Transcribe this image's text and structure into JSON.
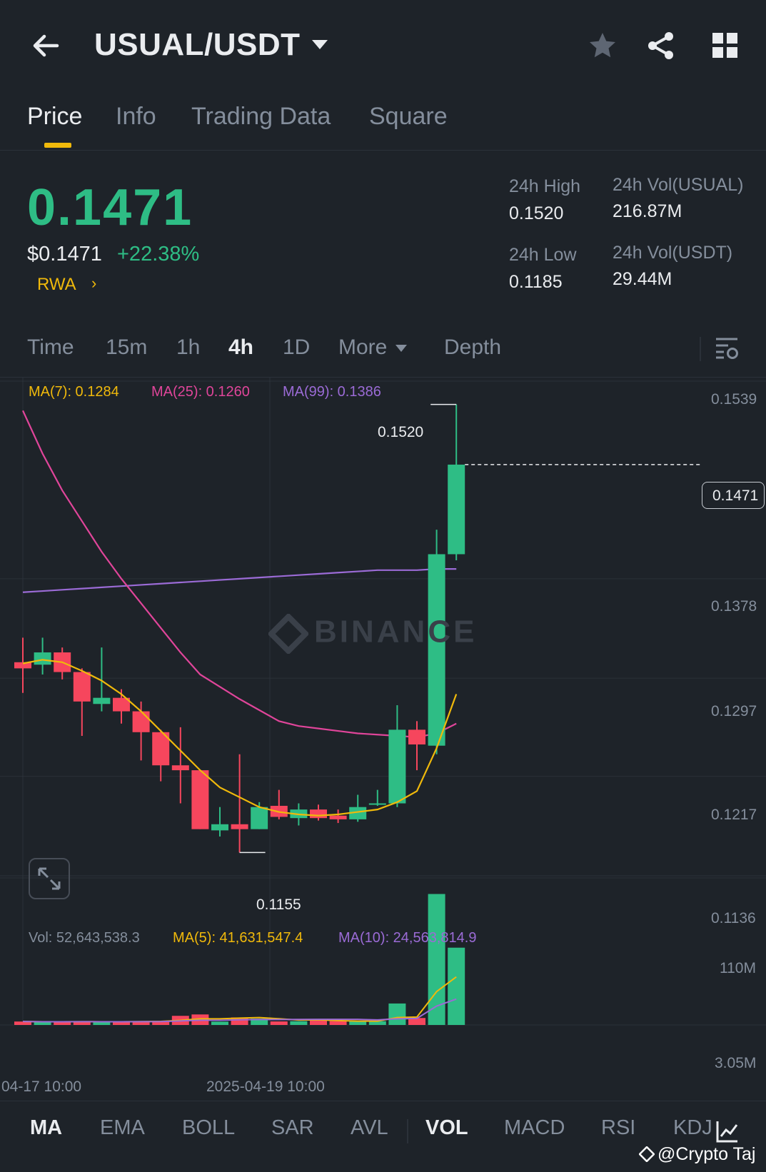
{
  "header": {
    "pair": "USUAL/USDT",
    "back_icon": "arrow-left-icon",
    "star_icon": "star-icon",
    "share_icon": "share-icon",
    "grid_icon": "grid-icon"
  },
  "tabs": [
    {
      "label": "Price",
      "active": true
    },
    {
      "label": "Info",
      "active": false
    },
    {
      "label": "Trading Data",
      "active": false
    },
    {
      "label": "Square",
      "active": false
    }
  ],
  "ticker": {
    "last_price": "0.1471",
    "fiat_price": "$0.1471",
    "change": "+22.38%",
    "tag": "RWA",
    "tag_arrow": "›",
    "high_label": "24h High",
    "high_value": "0.1520",
    "low_label": "24h Low",
    "low_value": "0.1185",
    "vol_base_label": "24h Vol(USUAL)",
    "vol_base_value": "216.87M",
    "vol_quote_label": "24h Vol(USDT)",
    "vol_quote_value": "29.44M"
  },
  "intervals": [
    {
      "label": "Time",
      "active": false
    },
    {
      "label": "15m",
      "active": false
    },
    {
      "label": "1h",
      "active": false
    },
    {
      "label": "4h",
      "active": true
    },
    {
      "label": "1D",
      "active": false
    },
    {
      "label": "More",
      "active": false
    },
    {
      "label": "Depth",
      "active": false
    }
  ],
  "ma_legend": {
    "ma7": "MA(7): 0.1284",
    "ma25": "MA(25): 0.1260",
    "ma99": "MA(99): 0.1386"
  },
  "vol_legend": {
    "vol": "Vol: 52,643,538.3",
    "ma5": "MA(5): 41,631,547.4",
    "ma10": "MA(10): 24,563,814.9"
  },
  "colors": {
    "up": "#2ebd85",
    "down": "#f6465d",
    "ma7": "#f0b90b",
    "ma25": "#e0459a",
    "ma99": "#9b6bd6",
    "background": "#1e2329"
  },
  "watermark": "BINANCE",
  "indicators": [
    {
      "label": "MA",
      "active": true
    },
    {
      "label": "EMA",
      "active": false
    },
    {
      "label": "BOLL",
      "active": false
    },
    {
      "label": "SAR",
      "active": false
    },
    {
      "label": "AVL",
      "active": false
    },
    {
      "label": "VOL",
      "active": true
    },
    {
      "label": "MACD",
      "active": false
    },
    {
      "label": "RSI",
      "active": false
    },
    {
      "label": "KDJ",
      "active": false
    }
  ],
  "footer_tag": "@Crypto Taj",
  "chart_data": {
    "type": "candlestick",
    "price_axis_labels": [
      "0.1539",
      "0.1378",
      "0.1297",
      "0.1217",
      "0.1136"
    ],
    "price_ylim": [
      0.1136,
      0.1539
    ],
    "current_price_label": "0.1471",
    "high_marker": "0.1520",
    "low_marker": "0.1155",
    "volume_axis_labels": [
      "110M",
      "3.05M"
    ],
    "x_labels": [
      "04-17 10:00",
      "2025-04-19 10:00"
    ],
    "candles": [
      {
        "o": 0.131,
        "h": 0.133,
        "l": 0.1285,
        "c": 0.1305
      },
      {
        "o": 0.1308,
        "h": 0.133,
        "l": 0.13,
        "c": 0.1318
      },
      {
        "o": 0.1318,
        "h": 0.1322,
        "l": 0.1296,
        "c": 0.1302
      },
      {
        "o": 0.1302,
        "h": 0.1305,
        "l": 0.125,
        "c": 0.1278
      },
      {
        "o": 0.1276,
        "h": 0.1322,
        "l": 0.127,
        "c": 0.1281
      },
      {
        "o": 0.1281,
        "h": 0.1288,
        "l": 0.126,
        "c": 0.127
      },
      {
        "o": 0.127,
        "h": 0.1278,
        "l": 0.123,
        "c": 0.1253
      },
      {
        "o": 0.1253,
        "h": 0.1255,
        "l": 0.1213,
        "c": 0.1226
      },
      {
        "o": 0.1226,
        "h": 0.1257,
        "l": 0.1195,
        "c": 0.1222
      },
      {
        "o": 0.1222,
        "h": 0.1222,
        "l": 0.1174,
        "c": 0.1174
      },
      {
        "o": 0.1173,
        "h": 0.1192,
        "l": 0.1168,
        "c": 0.1178
      },
      {
        "o": 0.1178,
        "h": 0.1235,
        "l": 0.1155,
        "c": 0.1174
      },
      {
        "o": 0.1174,
        "h": 0.1196,
        "l": 0.1174,
        "c": 0.1192
      },
      {
        "o": 0.1193,
        "h": 0.1206,
        "l": 0.1182,
        "c": 0.1184
      },
      {
        "o": 0.1183,
        "h": 0.1195,
        "l": 0.1177,
        "c": 0.119
      },
      {
        "o": 0.119,
        "h": 0.1194,
        "l": 0.1181,
        "c": 0.1183
      },
      {
        "o": 0.1185,
        "h": 0.119,
        "l": 0.1179,
        "c": 0.1182
      },
      {
        "o": 0.1182,
        "h": 0.1202,
        "l": 0.118,
        "c": 0.1192
      },
      {
        "o": 0.1194,
        "h": 0.1206,
        "l": 0.1193,
        "c": 0.1195
      },
      {
        "o": 0.1195,
        "h": 0.1275,
        "l": 0.1192,
        "c": 0.1255
      },
      {
        "o": 0.1255,
        "h": 0.1262,
        "l": 0.1222,
        "c": 0.1243
      },
      {
        "o": 0.1242,
        "h": 0.1418,
        "l": 0.1235,
        "c": 0.1398
      },
      {
        "o": 0.1398,
        "h": 0.152,
        "l": 0.1393,
        "c": 0.1471
      }
    ],
    "ma7": [
      0.1309,
      0.1312,
      0.131,
      0.1303,
      0.1295,
      0.1284,
      0.127,
      0.1254,
      0.1238,
      0.1222,
      0.1208,
      0.12,
      0.1192,
      0.1188,
      0.1186,
      0.1185,
      0.1186,
      0.1188,
      0.119,
      0.1196,
      0.1205,
      0.124,
      0.1284
    ],
    "ma25": [
      0.1515,
      0.148,
      0.145,
      0.1425,
      0.14,
      0.1378,
      0.1358,
      0.1338,
      0.1318,
      0.13,
      0.129,
      0.128,
      0.1271,
      0.1262,
      0.1258,
      0.1256,
      0.1254,
      0.1252,
      0.1251,
      0.125,
      0.1249,
      0.1252,
      0.126
    ],
    "ma99": [
      0.1367,
      0.1368,
      0.1369,
      0.137,
      0.1371,
      0.1372,
      0.1373,
      0.1374,
      0.1375,
      0.1376,
      0.1377,
      0.1378,
      0.1379,
      0.138,
      0.1381,
      0.1382,
      0.1383,
      0.1384,
      0.1385,
      0.1385,
      0.1385,
      0.1386,
      0.1386
    ],
    "volumes": [
      3.2,
      2.8,
      3.0,
      3.4,
      2.6,
      3.1,
      3.6,
      3.8,
      8.5,
      9.8,
      3.1,
      7.0,
      5.9,
      3.3,
      3.5,
      4.0,
      3.6,
      3.4,
      3.5,
      20.0,
      6.5,
      122.0,
      72.0
    ],
    "vol_ylim": [
      0,
      125
    ]
  }
}
